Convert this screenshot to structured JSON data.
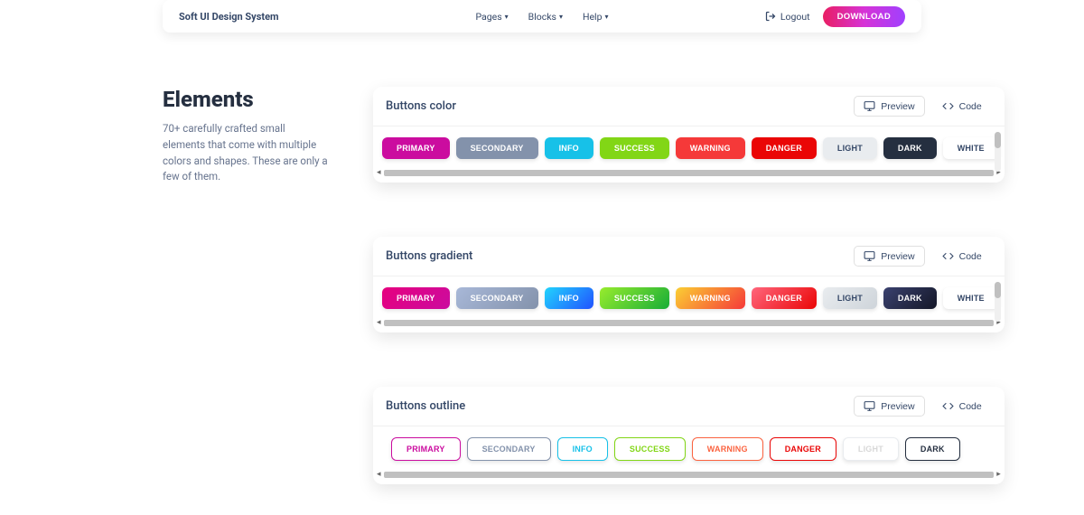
{
  "navbar": {
    "brand": "Soft UI Design System",
    "items": [
      {
        "label": "Pages"
      },
      {
        "label": "Blocks"
      },
      {
        "label": "Help"
      }
    ],
    "logout": "Logout",
    "download": "DOWNLOAD"
  },
  "sidebar": {
    "title": "Elements",
    "description": "70+ carefully crafted small elements that come with multiple colors and shapes. These are only a few of them."
  },
  "actions": {
    "preview": "Preview",
    "code": "Code"
  },
  "sections": [
    {
      "title": "Buttons color"
    },
    {
      "title": "Buttons gradient"
    },
    {
      "title": "Buttons outline"
    }
  ],
  "buttons": {
    "primary": "PRIMARY",
    "secondary": "SECONDARY",
    "info": "INFO",
    "success": "SUCCESS",
    "warning": "WARNING",
    "danger": "DANGER",
    "light": "LIGHT",
    "dark": "DARK",
    "white": "WHITE"
  }
}
